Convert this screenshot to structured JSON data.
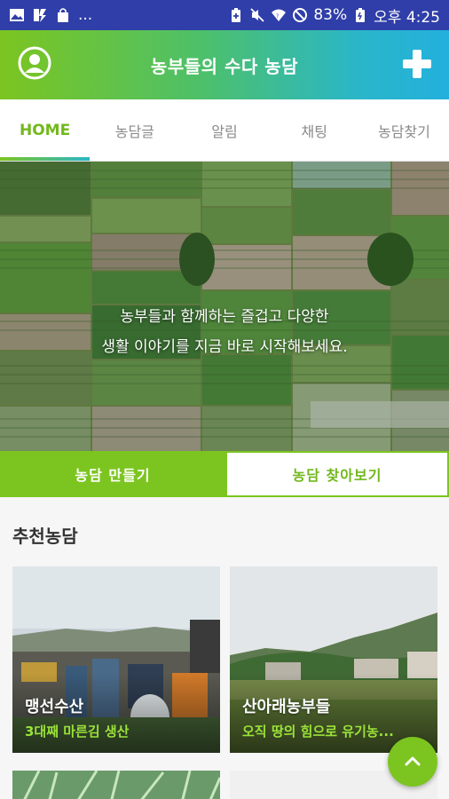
{
  "status_bar": {
    "left_icons": [
      "image-icon",
      "flash-icon",
      "bag-icon",
      "more-dots-icon"
    ],
    "more": "...",
    "battery_percent": "83%",
    "time": "오후 4:25"
  },
  "app_bar": {
    "title": "농부들의 수다 농담"
  },
  "tabs": [
    {
      "label": "HOME",
      "active": true
    },
    {
      "label": "농담글",
      "active": false
    },
    {
      "label": "알림",
      "active": false
    },
    {
      "label": "채팅",
      "active": false
    },
    {
      "label": "농담찾기",
      "active": false
    }
  ],
  "hero": {
    "line1": "농부들과 함께하는 즐겁고 다양한",
    "line2": "생활 이야기를 지금 바로 시작해보세요."
  },
  "actions": {
    "make_label": "농담 만들기",
    "browse_label": "농담 찾아보기"
  },
  "recommended": {
    "title": "추천농담",
    "cards": [
      {
        "name": "맹선수산",
        "desc": "3대째 마른김 생산"
      },
      {
        "name": "산아래농부들",
        "desc": "오직 땅의 힘으로 유기농..."
      }
    ]
  },
  "colors": {
    "status_bar": "#2f3ea8",
    "accent_green": "#7cc520",
    "accent_cyan": "#22b0dd",
    "desc_green": "#9be23a"
  }
}
